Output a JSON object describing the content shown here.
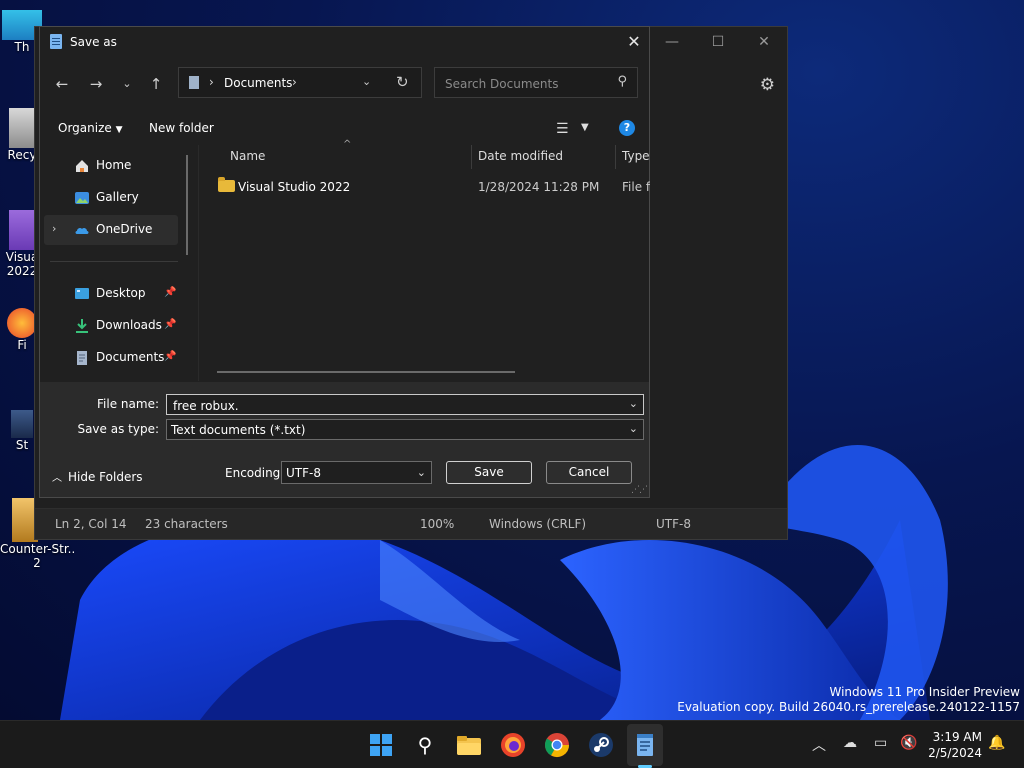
{
  "desktop": {
    "icons": [
      {
        "label": "Th"
      },
      {
        "label": "Recy"
      },
      {
        "label": "Visua"
      },
      {
        "label": "2022"
      },
      {
        "label": "Fi"
      },
      {
        "label": "St"
      },
      {
        "label": "Counter-Str..."
      },
      {
        "label": "2"
      }
    ]
  },
  "notepad": {
    "status": {
      "position": "Ln 2, Col 14",
      "characters": "23 characters",
      "zoom": "100%",
      "line_ending": "Windows (CRLF)",
      "encoding": "UTF-8"
    }
  },
  "dialog": {
    "title": "Save as",
    "close_glyph": "✕",
    "address": {
      "crumb": "Documents",
      "sep": "›"
    },
    "search": {
      "placeholder": "Search Documents"
    },
    "commands": {
      "organize": "Organize",
      "new_folder": "New folder",
      "help": "?"
    },
    "nav": {
      "items": [
        {
          "label": "Home"
        },
        {
          "label": "Gallery"
        },
        {
          "label": "OneDrive"
        },
        {
          "label": "Desktop"
        },
        {
          "label": "Downloads"
        },
        {
          "label": "Documents"
        }
      ]
    },
    "columns": {
      "name": "Name",
      "date": "Date modified",
      "type": "Type"
    },
    "files": [
      {
        "name": "Visual Studio 2022",
        "date": "1/28/2024 11:28 PM",
        "type": "File fo"
      }
    ],
    "form": {
      "file_name_label": "File name:",
      "file_name_value": "free robux.",
      "save_type_label": "Save as type:",
      "save_type_value": "Text documents (*.txt)",
      "encoding_label": "Encoding:",
      "encoding_value": "UTF-8",
      "save": "Save",
      "cancel": "Cancel",
      "hide_folders": "Hide Folders"
    }
  },
  "watermark": {
    "line1": "Windows 11 Pro Insider Preview",
    "line2": "Evaluation copy. Build 26040.rs_prerelease.240122-1157"
  },
  "clock": {
    "time": "3:19 AM",
    "date": "2/5/2024"
  },
  "colors": {
    "accent": "#60cdff",
    "folder": "#e8b93a",
    "help": "#1e88e5"
  }
}
